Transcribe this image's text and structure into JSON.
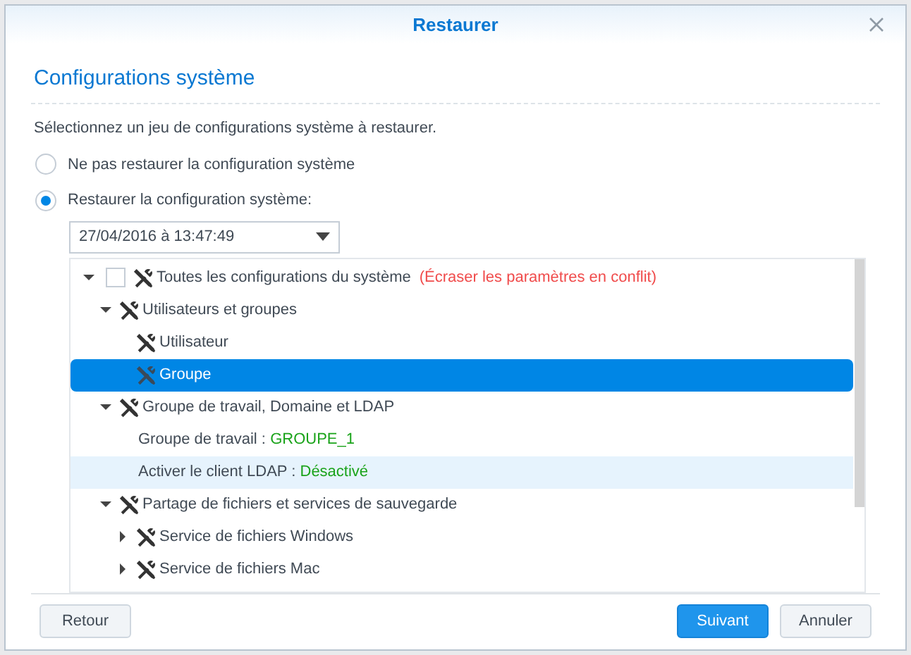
{
  "window": {
    "title": "Restaurer"
  },
  "section_title": "Configurations système",
  "instruction": "Sélectionnez un jeu de configurations système à restaurer.",
  "options": [
    {
      "label": "Ne pas restaurer la configuration système",
      "selected": false
    },
    {
      "label": "Restaurer la configuration système:",
      "selected": true
    }
  ],
  "backup_select": {
    "value": "27/04/2016 à 13:47:49"
  },
  "tree": [
    {
      "kind": "group",
      "label": "Toutes les configurations du système",
      "note": "(Écraser les paramètres en conflit)",
      "checked": false,
      "expanded": true,
      "selected": false,
      "hovered": false,
      "children": [
        {
          "kind": "group",
          "label": "Utilisateurs et groupes",
          "expanded": true,
          "selected": false,
          "hovered": false,
          "children": [
            {
              "kind": "leaf",
              "label": "Utilisateur",
              "selected": false,
              "hovered": false
            },
            {
              "kind": "leaf",
              "label": "Groupe",
              "selected": true,
              "hovered": false
            }
          ]
        },
        {
          "kind": "group",
          "label": "Groupe de travail, Domaine et LDAP",
          "expanded": true,
          "selected": false,
          "hovered": false,
          "children": [
            {
              "kind": "setting",
              "label": "Groupe de travail :",
              "value": "GROUPE_1",
              "selected": false,
              "hovered": false
            },
            {
              "kind": "setting",
              "label": "Activer le client LDAP :",
              "value": "Désactivé",
              "selected": false,
              "hovered": true
            }
          ]
        },
        {
          "kind": "group",
          "label": "Partage de fichiers et services de sauvegarde",
          "expanded": true,
          "selected": false,
          "hovered": false,
          "children": [
            {
              "kind": "group",
              "label": "Service de fichiers Windows",
              "expanded": false,
              "selected": false,
              "hovered": false
            },
            {
              "kind": "group",
              "label": "Service de fichiers Mac",
              "expanded": false,
              "selected": false,
              "hovered": false
            }
          ]
        }
      ]
    }
  ],
  "buttons": [
    {
      "label": "Retour",
      "kind": "secondary"
    },
    {
      "label": "Suivant",
      "kind": "primary"
    },
    {
      "label": "Annuler",
      "kind": "secondary"
    }
  ]
}
